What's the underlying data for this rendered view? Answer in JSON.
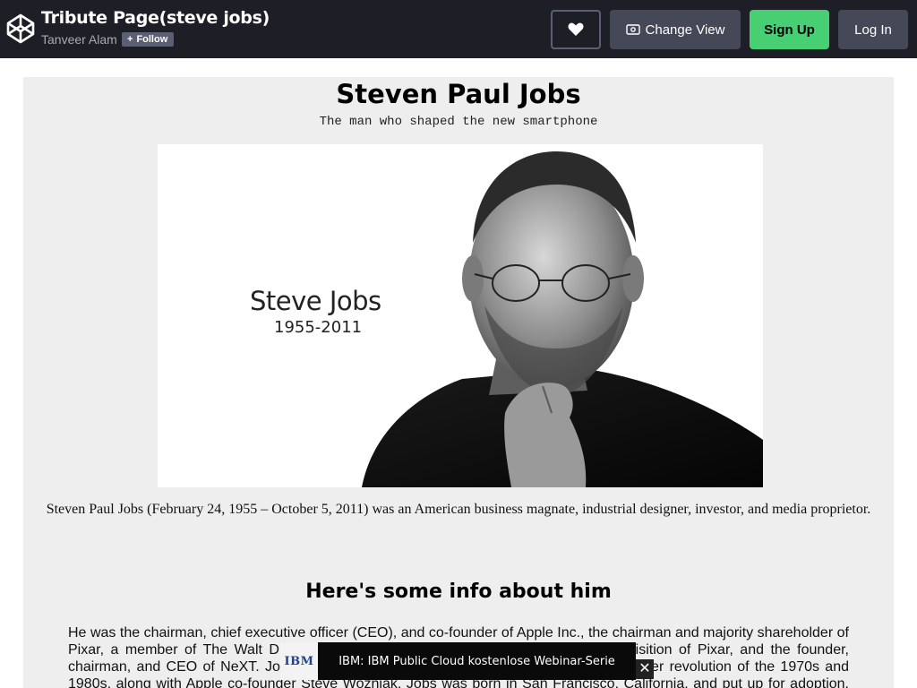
{
  "header": {
    "pen_title": "Tribute Page(steve jobs)",
    "author": "Tanveer Alam",
    "follow_label": "Follow",
    "change_view_label": "Change View",
    "signup_label": "Sign Up",
    "login_label": "Log In",
    "icons": {
      "logo": "codepen-logo-icon",
      "heart": "heart-icon",
      "change_view": "eye-icon",
      "follow": "plus-icon"
    },
    "colors": {
      "bar": "#1e1f26",
      "signup": "#47cf73",
      "button": "#444857"
    }
  },
  "tribute": {
    "title": "Steven Paul Jobs",
    "subtitle": "The man who shaped the new smartphone",
    "image": {
      "name_text": "Steve Jobs",
      "years_text": "1955-2011"
    },
    "caption": "Steven Paul Jobs (February 24, 1955 – October 5, 2011) was an American business magnate, industrial designer, investor, and media proprietor.",
    "info_heading": "Here's some info about him",
    "info_text": "He was the chairman, chief executive officer (CEO), and co-founder of Apple Inc., the chairman and majority shareholder of Pixar, a member of The Walt Disney Company's board of directors following its acquisition of Pixar, and the founder, chairman, and CEO of NeXT. Jobs is widely recognized as a pioneer of the microcomputer revolution of the 1970s and 1980s, along with Apple co-founder Steve Wozniak. Jobs was born in San Francisco, California, and put up for adoption. He",
    "background_color": "#eeeeee"
  },
  "ad": {
    "logo_text": "IBM",
    "text": "IBM: IBM Public Cloud kostenlose Webinar-Serie",
    "close_label": "✕"
  }
}
